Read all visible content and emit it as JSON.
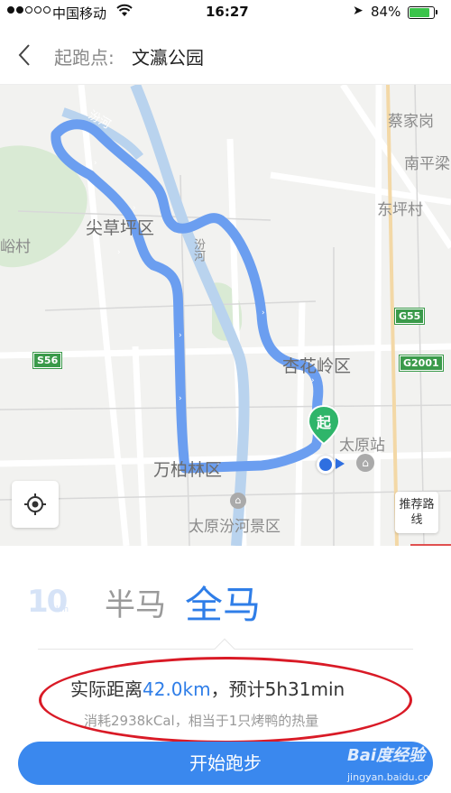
{
  "status_bar": {
    "carrier": "中国移动",
    "time": "16:27",
    "battery_percent": "84%",
    "battery_level": 0.84,
    "signal_bars": 2
  },
  "header": {
    "label": "起跑点:",
    "place": "文瀛公园"
  },
  "map": {
    "labels": {
      "caijiaying": "蔡家岗",
      "nanpingqu": "南平梁",
      "dongpingcun": "东坪村",
      "jiancaoping": "尖草坪区",
      "yucun": "峪村",
      "xinghualing": "杏花岭区",
      "taiyuan_station": "太原站",
      "wanbailin": "万柏林区",
      "fenhe_scenic": "太原汾河景区",
      "fenhe_river": "汾河",
      "river_top": "汾河"
    },
    "shields": {
      "g55": "G55",
      "s56": "S56",
      "g2001": "G2001"
    },
    "start_pin": "起",
    "route_button": "推荐路线",
    "route_color": "#6b9ef0"
  },
  "panel": {
    "option_10": "10",
    "option_10_unit": "km",
    "option_half": "半马",
    "option_full": "全马",
    "distance_prefix": "实际距离",
    "distance_value": "42.0km",
    "estimate": "，预计5h31min",
    "calories": "消耗2938kCal，相当于1只烤鸭的热量",
    "start_button": "开始跑步",
    "watermark": "Bai度经验",
    "watermark_sub": "jingyan.baidu.com"
  }
}
